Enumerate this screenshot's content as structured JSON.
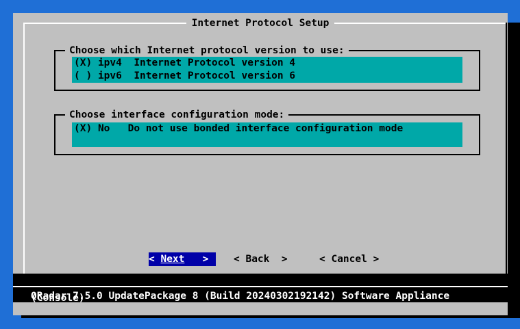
{
  "dialog": {
    "title": "Internet Protocol Setup"
  },
  "protocol_group": {
    "legend": "Choose which Internet protocol version to use:",
    "options": [
      {
        "marker": "(X)",
        "key": "ipv4",
        "label": "Internet Protocol version 4",
        "selected": true
      },
      {
        "marker": "( )",
        "key": "ipv6",
        "label": "Internet Protocol version 6",
        "selected": false
      }
    ]
  },
  "mode_group": {
    "legend": "Choose interface configuration mode:",
    "options": [
      {
        "marker": "(X)",
        "key": "No",
        "label": "Do not use bonded interface configuration mode",
        "selected": true
      }
    ]
  },
  "buttons": {
    "next_left": "<",
    "next_label": "Next",
    "next_right": ">",
    "back": "< Back  >",
    "cancel": "< Cancel >"
  },
  "footer": {
    "line1": "QRadar 7.5.0 UpdatePackage 8 (Build 20240302192142) Software Appliance",
    "line2": "(Console)"
  },
  "colors": {
    "background": "#1f6fd6",
    "dialog": "#c0c0c0",
    "highlight": "#00a8a8",
    "button_selected": "#0000a8"
  }
}
